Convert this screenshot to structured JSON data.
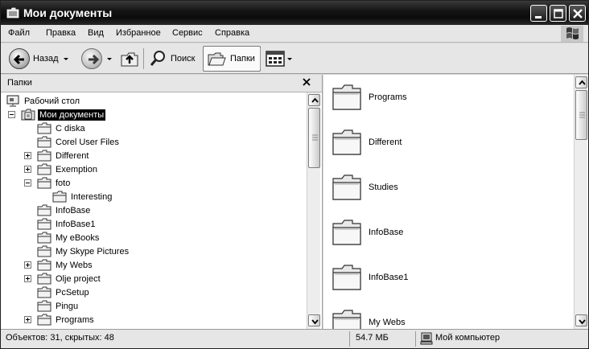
{
  "window": {
    "title": "Мои документы",
    "icon": "folder-icon",
    "controls": [
      "minimize-icon",
      "maximize-icon",
      "close-icon"
    ]
  },
  "menu": [
    "Файл",
    "Правка",
    "Вид",
    "Избранное",
    "Сервис",
    "Справка"
  ],
  "toolbar": {
    "back_label": "Назад",
    "search_label": "Поиск",
    "folders_label": "Папки"
  },
  "folders_pane": {
    "title": "Папки",
    "tree": [
      {
        "label": "Рабочий стол",
        "icon": "desktop-icon",
        "level": 0,
        "expander": "none"
      },
      {
        "label": "Мои документы",
        "icon": "my-documents-icon",
        "level": 1,
        "expander": "minus",
        "selected": true
      },
      {
        "label": "C diska",
        "icon": "folder-icon",
        "level": 2,
        "expander": "none"
      },
      {
        "label": "Corel User Files",
        "icon": "folder-icon",
        "level": 2,
        "expander": "none"
      },
      {
        "label": "Different",
        "icon": "folder-icon",
        "level": 2,
        "expander": "plus"
      },
      {
        "label": "Exemption",
        "icon": "folder-icon",
        "level": 2,
        "expander": "plus"
      },
      {
        "label": "foto",
        "icon": "folder-icon",
        "level": 2,
        "expander": "minus"
      },
      {
        "label": "Interesting",
        "icon": "folder-icon",
        "level": 3,
        "expander": "none"
      },
      {
        "label": "InfoBase",
        "icon": "folder-icon",
        "level": 2,
        "expander": "none"
      },
      {
        "label": "InfoBase1",
        "icon": "folder-icon",
        "level": 2,
        "expander": "none"
      },
      {
        "label": "My eBooks",
        "icon": "folder-icon",
        "level": 2,
        "expander": "none"
      },
      {
        "label": "My Skype Pictures",
        "icon": "folder-icon",
        "level": 2,
        "expander": "none"
      },
      {
        "label": "My Webs",
        "icon": "folder-icon",
        "level": 2,
        "expander": "plus"
      },
      {
        "label": "Olje project",
        "icon": "folder-icon",
        "level": 2,
        "expander": "plus"
      },
      {
        "label": "PcSetup",
        "icon": "folder-icon",
        "level": 2,
        "expander": "none"
      },
      {
        "label": "Pingu",
        "icon": "folder-icon",
        "level": 2,
        "expander": "none"
      },
      {
        "label": "Programs",
        "icon": "folder-icon",
        "level": 2,
        "expander": "plus"
      }
    ]
  },
  "content_items": [
    "Programs",
    "Different",
    "Studies",
    "InfoBase",
    "InfoBase1",
    "My Webs"
  ],
  "status": {
    "objects": "Объектов: 31, скрытых: 48",
    "size": "54.7 МБ",
    "location": "Мой компьютер",
    "location_icon": "my-computer-icon"
  }
}
